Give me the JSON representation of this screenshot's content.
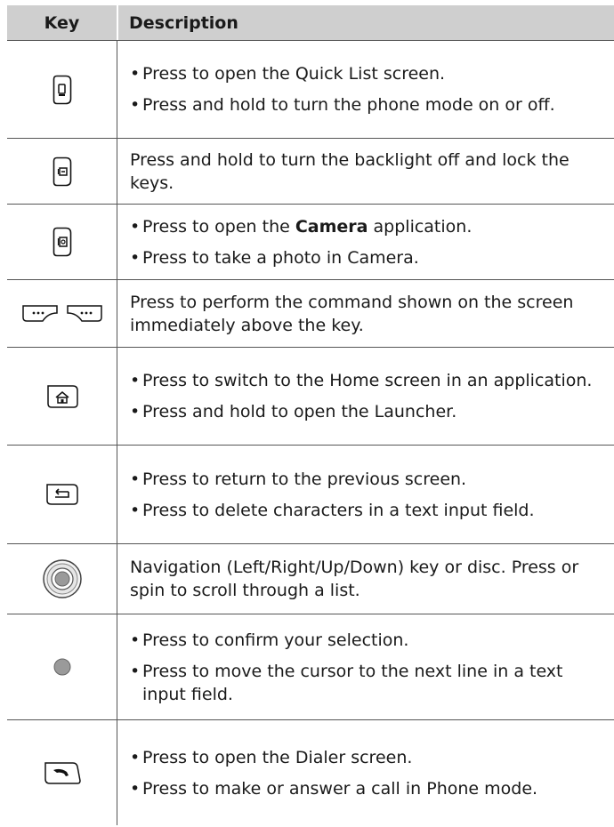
{
  "table": {
    "header": {
      "key": "Key",
      "description": "Description"
    },
    "rows": [
      {
        "icon": "phone-mode-key-icon",
        "items": [
          "Press to open the Quick List screen.",
          "Press and hold to turn the phone mode on or off."
        ]
      },
      {
        "icon": "lock-key-icon",
        "text": "Press and hold to turn the backlight off and lock the keys."
      },
      {
        "icon": "camera-key-icon",
        "items": [
          {
            "pre": "Press to open the ",
            "bold": "Camera",
            "post": " application."
          },
          "Press to take a photo in Camera."
        ]
      },
      {
        "icon": "soft-keys-icon",
        "text": "Press to perform the command shown on the screen immediately above the key."
      },
      {
        "icon": "home-key-icon",
        "items": [
          "Press to switch to the Home screen in an application.",
          "Press and hold to open the Launcher."
        ]
      },
      {
        "icon": "back-key-icon",
        "items": [
          "Press to return to the previous screen.",
          "Press to delete characters in a text input field."
        ]
      },
      {
        "icon": "navigation-disc-icon",
        "text": "Navigation (Left/Right/Up/Down) key or disc. Press or spin to scroll through a list."
      },
      {
        "icon": "confirm-key-icon",
        "items": [
          "Press to confirm your selection.",
          "Press to move the cursor to the next line in a text input field."
        ]
      },
      {
        "icon": "dial-key-icon",
        "items": [
          "Press to open the Dialer screen.",
          "Press to make or answer a call in Phone mode."
        ]
      }
    ]
  }
}
